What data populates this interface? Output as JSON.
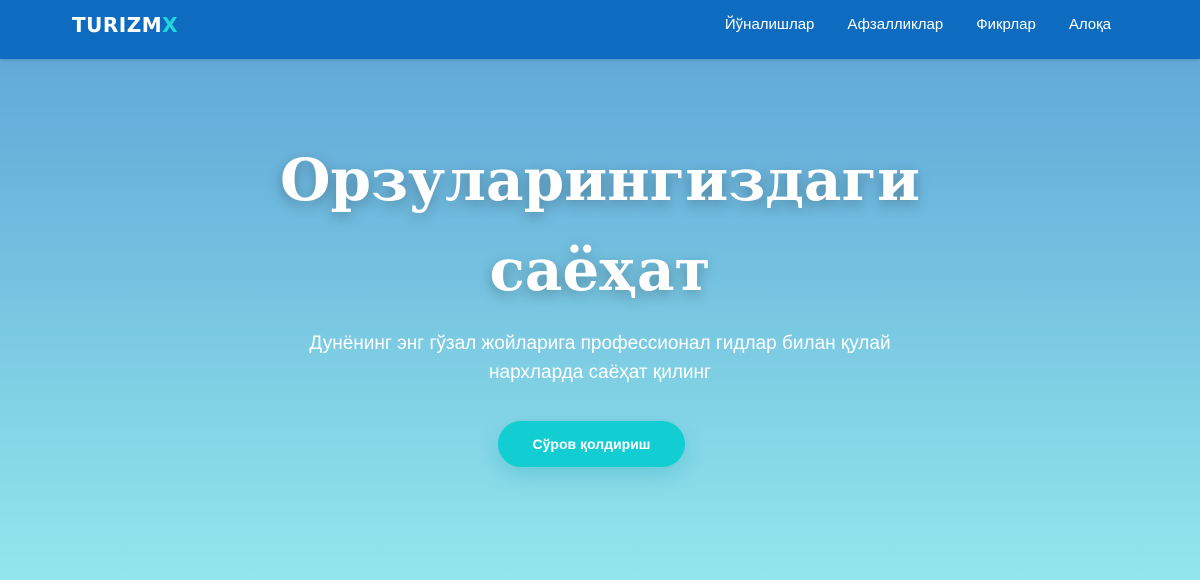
{
  "brand": {
    "logo_main": "TURIZM",
    "logo_accent": "X",
    "accent_color": "#23d5dc",
    "header_color": "#0d6cbf"
  },
  "nav": {
    "items": [
      {
        "label": "Йўналишлар"
      },
      {
        "label": "Афзалликлар"
      },
      {
        "label": "Фикрлар"
      },
      {
        "label": "Алоқа"
      }
    ]
  },
  "hero": {
    "title_line1": "Орзуларингиздаги",
    "title_line2": "саёҳат",
    "subtitle_line1": "Дунёнинг энг гўзал жойларига профессионал гидлар билан қулай",
    "subtitle_line2": "нархларда саёҳат қилинг",
    "cta_label": "Сўров қолдириш",
    "cta_color": "#12cdd2"
  }
}
